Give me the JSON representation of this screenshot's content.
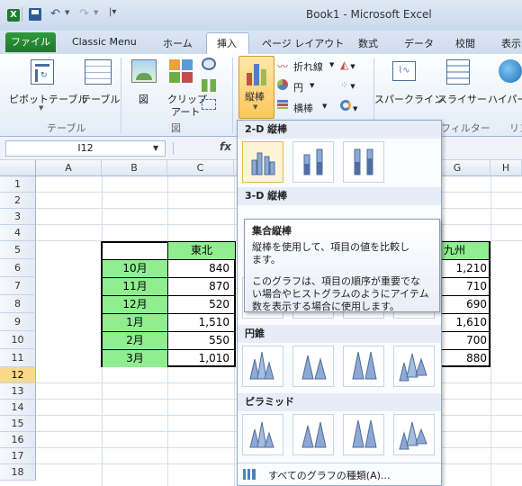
{
  "window": {
    "title": "Book1 - Microsoft Excel"
  },
  "tabs": {
    "file": "ファイル",
    "classic": "Classic Menu",
    "home": "ホーム",
    "insert": "挿入",
    "page_layout": "ページ レイアウト",
    "formulas": "数式",
    "data": "データ",
    "review": "校閲",
    "view": "表示"
  },
  "ribbon": {
    "pivot": "ピボットテーブル",
    "table": "テーブル",
    "group_table": "テーブル",
    "picture": "図",
    "clipart": "クリップ",
    "clipart2": "アート",
    "group_fig": "図",
    "column": "縦棒",
    "line": "折れ線",
    "pie": "円",
    "bar": "横棒",
    "sparkline": "スパークライン",
    "slicer": "スライサー",
    "hyperlink": "ハイパー",
    "group_filter": "フィルター",
    "group_link": "リン"
  },
  "formula": {
    "namebox": "I12",
    "fx": "fx"
  },
  "columns": [
    "A",
    "B",
    "C",
    "D",
    "E",
    "F",
    "G",
    "H"
  ],
  "rows": [
    "1",
    "2",
    "3",
    "4",
    "5",
    "6",
    "7",
    "8",
    "9",
    "10",
    "11",
    "12",
    "13",
    "14",
    "15",
    "16",
    "17",
    "18"
  ],
  "table": {
    "header_c": "東北",
    "header_g": "九州",
    "months": [
      "10月",
      "11月",
      "12月",
      "1月",
      "2月",
      "3月"
    ],
    "col_c": [
      "840",
      "870",
      "520",
      "1,510",
      "550",
      "1,010"
    ],
    "col_g": [
      "1,210",
      "710",
      "690",
      "1,610",
      "700",
      "880"
    ]
  },
  "dropdown": {
    "section_2d": "2-D 縦棒",
    "section_3d": "3-D 縦棒",
    "section_cone": "円錐",
    "section_pyramid": "ピラミッド",
    "all_types": "すべてのグラフの種類(A)..."
  },
  "tooltip": {
    "title": "集合縦棒",
    "line1": "縦棒を使用して、項目の値を比較し",
    "line2": "ます。",
    "line3": "このグラフは、項目の順序が重要でな",
    "line4": "い場合やヒストグラムのようにアイテム",
    "line5": "数を表示する場合に使用します。"
  }
}
